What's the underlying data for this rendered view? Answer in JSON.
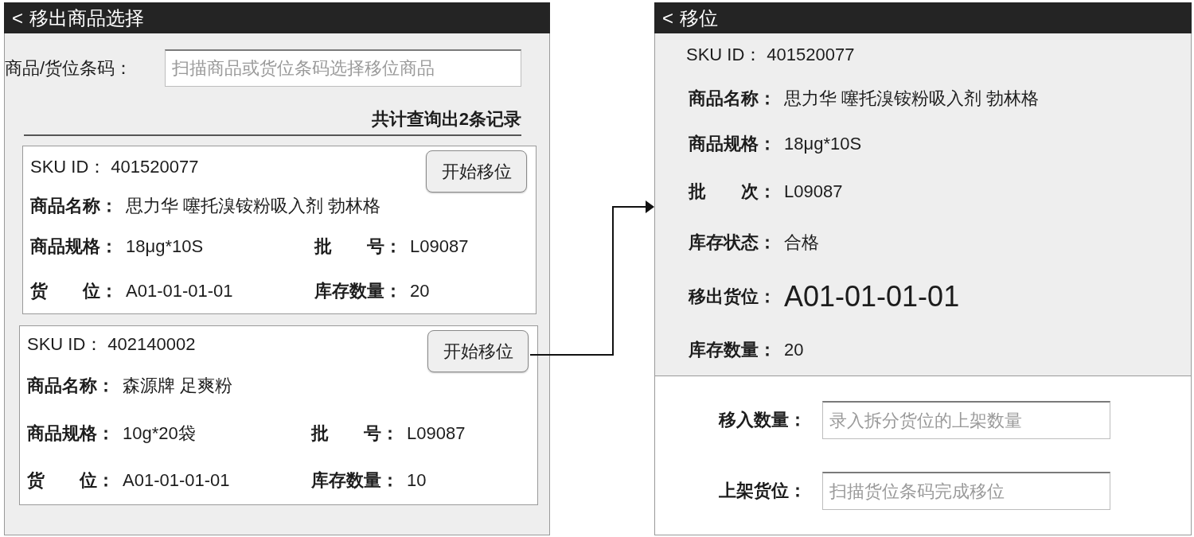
{
  "left_screen": {
    "back": "<",
    "title": "移出商品选择",
    "search": {
      "label": "商品/货位条码：",
      "placeholder": "扫描商品或货位条码选择移位商品"
    },
    "result_count": "共计查询出2条记录",
    "products": [
      {
        "sku_label": "SKU ID：",
        "sku": "401520077",
        "button": "开始移位",
        "name_label": "商品名称：",
        "name": "思力华 噻托溴铵粉吸入剂 勃林格",
        "spec_label": "商品规格：",
        "spec": "18μg*10S",
        "batch_label": "批　　号：",
        "batch": "L09087",
        "location_label": "货　　位：",
        "location": "A01-01-01-01",
        "stock_label": "库存数量：",
        "stock": "20"
      },
      {
        "sku_label": "SKU ID：",
        "sku": "402140002",
        "button": "开始移位",
        "name_label": "商品名称：",
        "name": "森源牌 足爽粉",
        "spec_label": "商品规格：",
        "spec": "10g*20袋",
        "batch_label": "批　　号：",
        "batch": "L09087",
        "location_label": "货　　位：",
        "location": "A01-01-01-01",
        "stock_label": "库存数量：",
        "stock": "10"
      }
    ]
  },
  "right_screen": {
    "back": "<",
    "title": "移位",
    "details": [
      {
        "kind": "id",
        "label": "SKU ID：",
        "value": "401520077"
      },
      {
        "kind": "field",
        "label": "商品名称：",
        "value": "思力华 噻托溴铵粉吸入剂 勃林格"
      },
      {
        "kind": "field",
        "label": "商品规格：",
        "value": "18μg*10S"
      },
      {
        "kind": "field",
        "label": "批　　次：",
        "value": "L09087"
      },
      {
        "kind": "field",
        "label": "库存状态：",
        "value": "合格"
      },
      {
        "kind": "large",
        "label": "移出货位：",
        "value": "A01-01-01-01"
      },
      {
        "kind": "field",
        "label": "库存数量：",
        "value": "20"
      }
    ],
    "inputs": [
      {
        "label": "移入数量：",
        "placeholder": "录入拆分货位的上架数量"
      },
      {
        "label": "上架货位：",
        "placeholder": "扫描货位条码完成移位"
      }
    ]
  }
}
